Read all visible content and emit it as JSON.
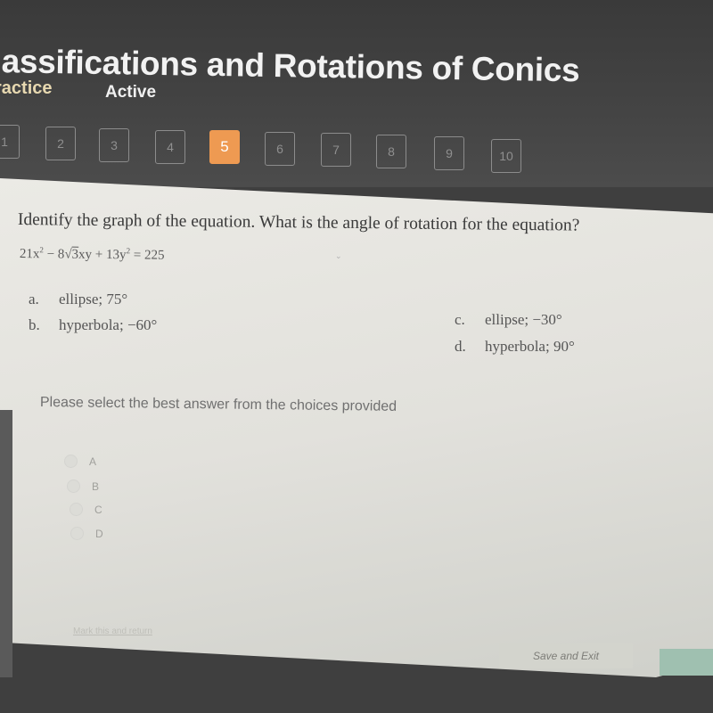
{
  "header": {
    "title": "lassifications and Rotations of Conics",
    "tabs": [
      {
        "label": "ractice"
      },
      {
        "label": "Active"
      }
    ]
  },
  "question_nav": {
    "current": 5,
    "items": [
      {
        "label": "1"
      },
      {
        "label": "2"
      },
      {
        "label": "3"
      },
      {
        "label": "4"
      },
      {
        "label": "5"
      },
      {
        "label": "6"
      },
      {
        "label": "7"
      },
      {
        "label": "8"
      },
      {
        "label": "9"
      },
      {
        "label": "10"
      }
    ],
    "accent_color": "#ee9a52"
  },
  "question": {
    "text": "Identify the graph of the equation. What is the angle of rotation for the equation?",
    "equation": {
      "term1": "21x",
      "exp1": "2",
      "op1": " − 8",
      "radicand": "3",
      "term2": "xy + 13y",
      "exp2": "2",
      "rhs": " = 225"
    },
    "choices": [
      {
        "letter": "a.",
        "text": "ellipse; 75°"
      },
      {
        "letter": "b.",
        "text": "hyperbola; −60°"
      },
      {
        "letter": "c.",
        "text": "ellipse; −30°"
      },
      {
        "letter": "d.",
        "text": "hyperbola; 90°"
      }
    ]
  },
  "answer": {
    "prompt": "Please select the best answer from the choices provided",
    "options": [
      {
        "label": "A"
      },
      {
        "label": "B"
      },
      {
        "label": "C"
      },
      {
        "label": "D"
      }
    ]
  },
  "footer": {
    "mark_link": "Mark this and return",
    "save_exit": "Save and Exit"
  }
}
